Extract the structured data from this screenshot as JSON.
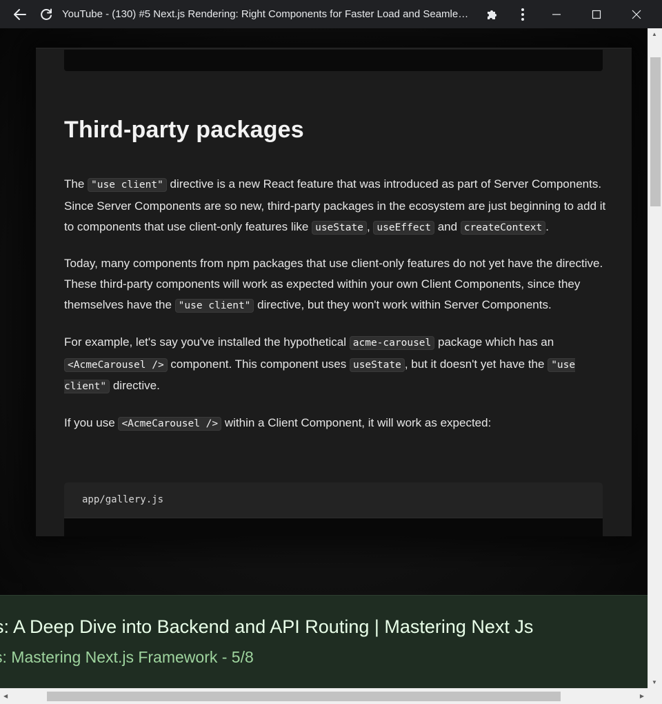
{
  "window": {
    "title": "YouTube - (130) #5 Next.js Rendering: Right Components for Faster Load and Seamless Interactivity"
  },
  "icons": {
    "back": "arrow-left-icon",
    "reload": "reload-icon",
    "extensions": "puzzle-icon",
    "menu": "kebab-menu-icon",
    "minimize": "minimize-icon",
    "maximize": "maximize-icon",
    "close": "close-icon"
  },
  "doc": {
    "heading": "Third-party packages",
    "p1": {
      "t1": "The ",
      "c1": "\"use client\"",
      "t2": " directive is a new React feature that was introduced as part of Server Components. Since Server Components are so new, third-party packages in the ecosystem are just beginning to add it to components that use client-only features like ",
      "c2": "useState",
      "t3": ", ",
      "c3": "useEffect",
      "t4": " and ",
      "c4": "createContext",
      "t5": "."
    },
    "p2": {
      "t1": "Today, many components from npm packages that use client-only features do not yet have the directive. These third-party components will work as expected within your own Client Components, since they themselves have the ",
      "c1": "\"use client\"",
      "t2": " directive, but they won't work within Server Components."
    },
    "p3": {
      "t1": "For example, let's say you've installed the hypothetical ",
      "c1": "acme-carousel",
      "t2": " package which has an ",
      "c2": "<AcmeCarousel />",
      "t3": " component. This component uses ",
      "c3": "useState",
      "t4": ", but it doesn't yet have the ",
      "c4": "\"use client\"",
      "t5": " directive."
    },
    "p4": {
      "t1": "If you use ",
      "c1": "<AcmeCarousel />",
      "t2": " within a Client Component, it will work as expected:"
    },
    "code_filename": "app/gallery.js"
  },
  "info": {
    "title": "js: A Deep Dive into Backend and API Routing | Mastering Next Js",
    "subtitle": "s: Mastering Next.js Framework - 5/8"
  },
  "colors": {
    "titlebar": "#202124",
    "info_panel": "#1f2d22",
    "info_title": "#e9ffe9",
    "info_sub": "#9ed49e"
  }
}
